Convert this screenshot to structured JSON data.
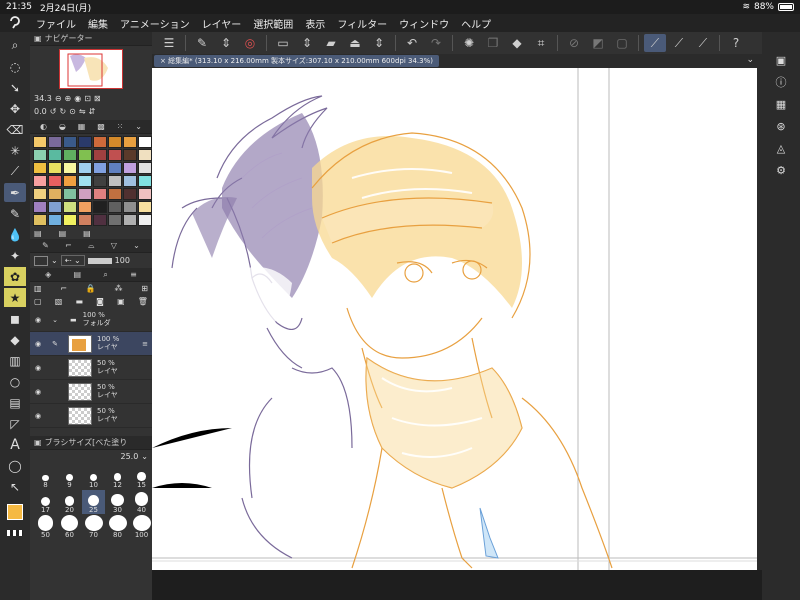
{
  "status_bar": {
    "time": "21:35",
    "date": "2月24日(月)",
    "battery": "88%"
  },
  "menu": [
    "ファイル",
    "編集",
    "アニメーション",
    "レイヤー",
    "選択範囲",
    "表示",
    "フィルター",
    "ウィンドウ",
    "ヘルプ"
  ],
  "document": {
    "tab_label": "総集編* (313.10 x 216.00mm 製本サイズ:307.10 x 210.00mm 600dpi 34.3%)"
  },
  "navigator": {
    "title": "ナビゲーター",
    "zoom": "34.3",
    "rotation": "0.0"
  },
  "tool_property": {
    "opacity": "100"
  },
  "layers": [
    {
      "opacity": "100 %",
      "name": "フォルダ",
      "type": "folder"
    },
    {
      "opacity": "100 %",
      "name": "レイヤ",
      "type": "layer",
      "selected": true
    },
    {
      "opacity": "50 %",
      "name": "レイヤ",
      "type": "layer"
    },
    {
      "opacity": "50 %",
      "name": "レイヤ",
      "type": "layer"
    },
    {
      "opacity": "50 %",
      "name": "レイヤ",
      "type": "layer"
    }
  ],
  "brush_size": {
    "title": "ブラシサイズ[べた塗り",
    "value": "25.0",
    "sizes": [
      "8",
      "9",
      "10",
      "12",
      "15",
      "17",
      "20",
      "25",
      "30",
      "40",
      "50",
      "60",
      "70",
      "80",
      "100"
    ]
  },
  "swatches": [
    "#f5c96a",
    "#7a6a9a",
    "#3a5a8a",
    "#2a3a6a",
    "#ce6a3a",
    "#d48a2a",
    "#e8a040",
    "#ffffff",
    "#8cd0b0",
    "#5abaa0",
    "#60b060",
    "#80c050",
    "#a04040",
    "#c05050",
    "#5a3a2a",
    "#f0e0c0",
    "#f0c040",
    "#e8e060",
    "#f8f8a0",
    "#a0d0f0",
    "#80a0e0",
    "#6080c0",
    "#c0a0e0",
    "#e0e0e0",
    "#f8a0a0",
    "#e86060",
    "#f0a040",
    "#a0e0f0",
    "#404040",
    "#c0c0c0",
    "#a0c0e0",
    "#80e0e0",
    "#f0d080",
    "#e0b060",
    "#80c0a0",
    "#d0a0c0",
    "#e08080",
    "#c07040",
    "#503030",
    "#f0c0c0",
    "#a080c0",
    "#80a0d0",
    "#d0e080",
    "#f0a060",
    "#202020",
    "#606060",
    "#909090",
    "#f8e0a0",
    "#e0c060",
    "#70b0e0",
    "#f0f060",
    "#d08060",
    "#503040",
    "#707070",
    "#b0b0b0",
    "#f0f0f0"
  ]
}
